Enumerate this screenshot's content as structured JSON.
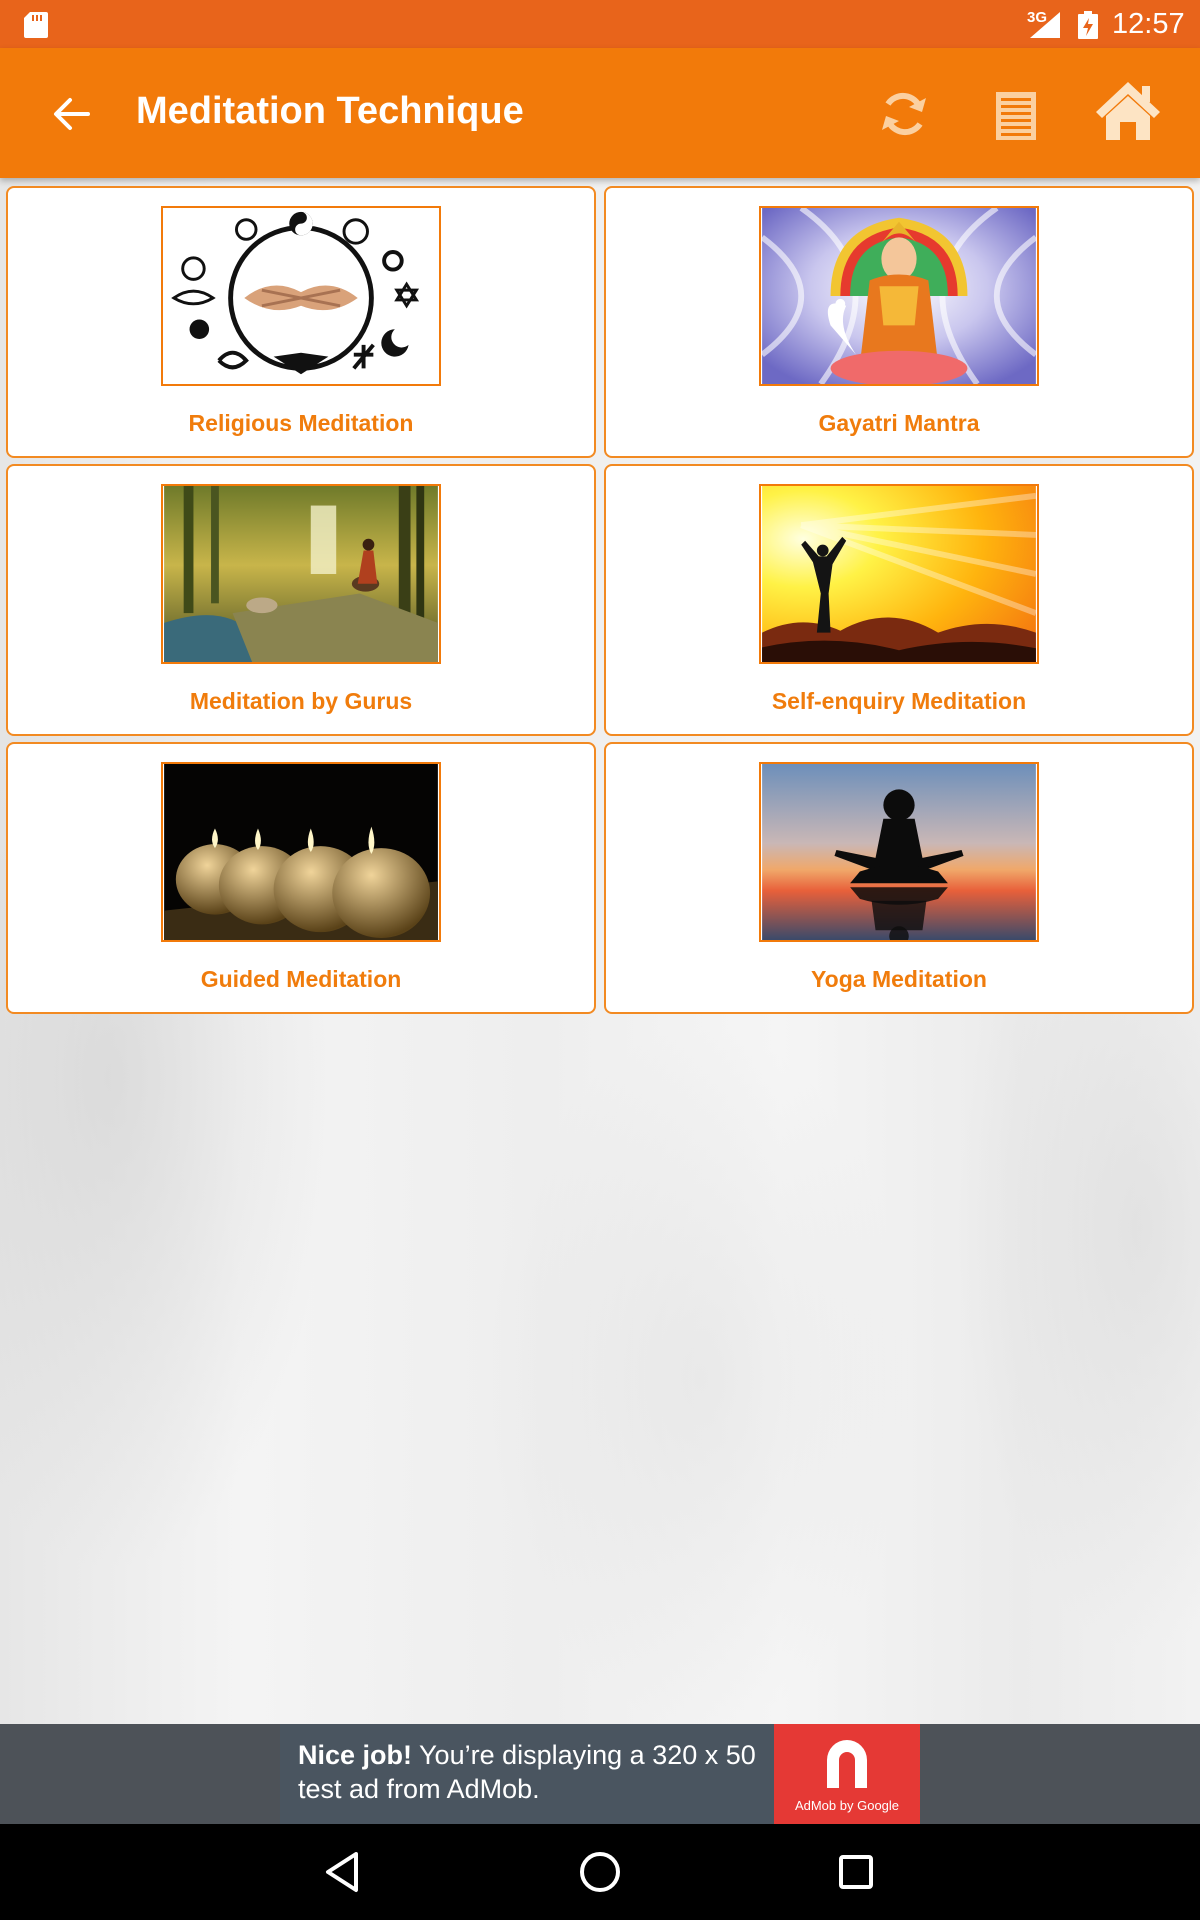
{
  "status_bar": {
    "network": "3G",
    "time": "12:57"
  },
  "app_bar": {
    "title": "Meditation Technique",
    "icons": [
      "arrow-back-icon",
      "refresh-icon",
      "list-icon",
      "home-icon"
    ]
  },
  "cards": [
    {
      "label": "Religious Meditation"
    },
    {
      "label": "Gayatri Mantra"
    },
    {
      "label": "Meditation by Gurus"
    },
    {
      "label": "Self-enquiry Meditation"
    },
    {
      "label": "Guided Meditation"
    },
    {
      "label": "Yoga Meditation"
    }
  ],
  "ad": {
    "headline": "Nice job!",
    "body": " You’re displaying a 320 x 50 test ad from AdMob.",
    "logo_text": "AdMob by Google"
  },
  "colors": {
    "status_bar": "#e8641b",
    "app_bar": "#f27a0a",
    "card_border": "#f28a22",
    "label": "#f07c0c",
    "ad_logo": "#e53935"
  }
}
